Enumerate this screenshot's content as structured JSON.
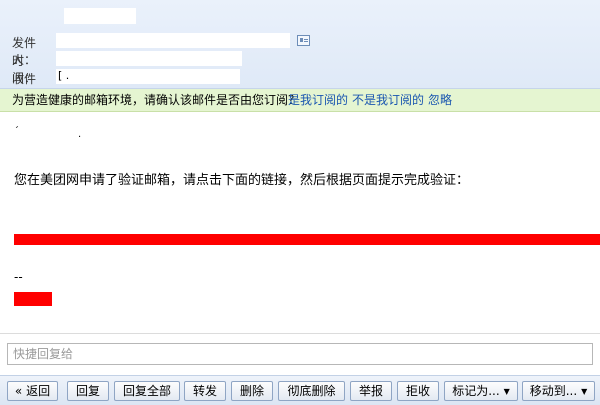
{
  "header": {
    "from_label": "发件人：",
    "time_label": "时　间：",
    "to_label": "收件人：",
    "to_value_visible": "[ ."
  },
  "notice": {
    "text": "为营造健康的邮箱环境，请确认该邮件是否由您订阅？",
    "link_yes": "是我订阅的",
    "link_no": "不是我订阅的",
    "link_ignore": "忽略"
  },
  "body": {
    "message": "您在美团网申请了验证邮箱，请点击下面的链接，然后根据页面提示完成验证：",
    "signature_sep": "--"
  },
  "quick_reply": {
    "placeholder": "快捷回复给"
  },
  "toolbar": {
    "back": "« 返回",
    "reply": "回复",
    "reply_all": "回复全部",
    "forward": "转发",
    "delete": "删除",
    "delete_permanent": "彻底删除",
    "report": "举报",
    "reject": "拒收",
    "mark_as": "标记为...",
    "move_to": "移动到..."
  },
  "colors": {
    "link": "#1a56b0",
    "notice_bg": "#e5f5d1",
    "redaction": "#ff0000"
  }
}
